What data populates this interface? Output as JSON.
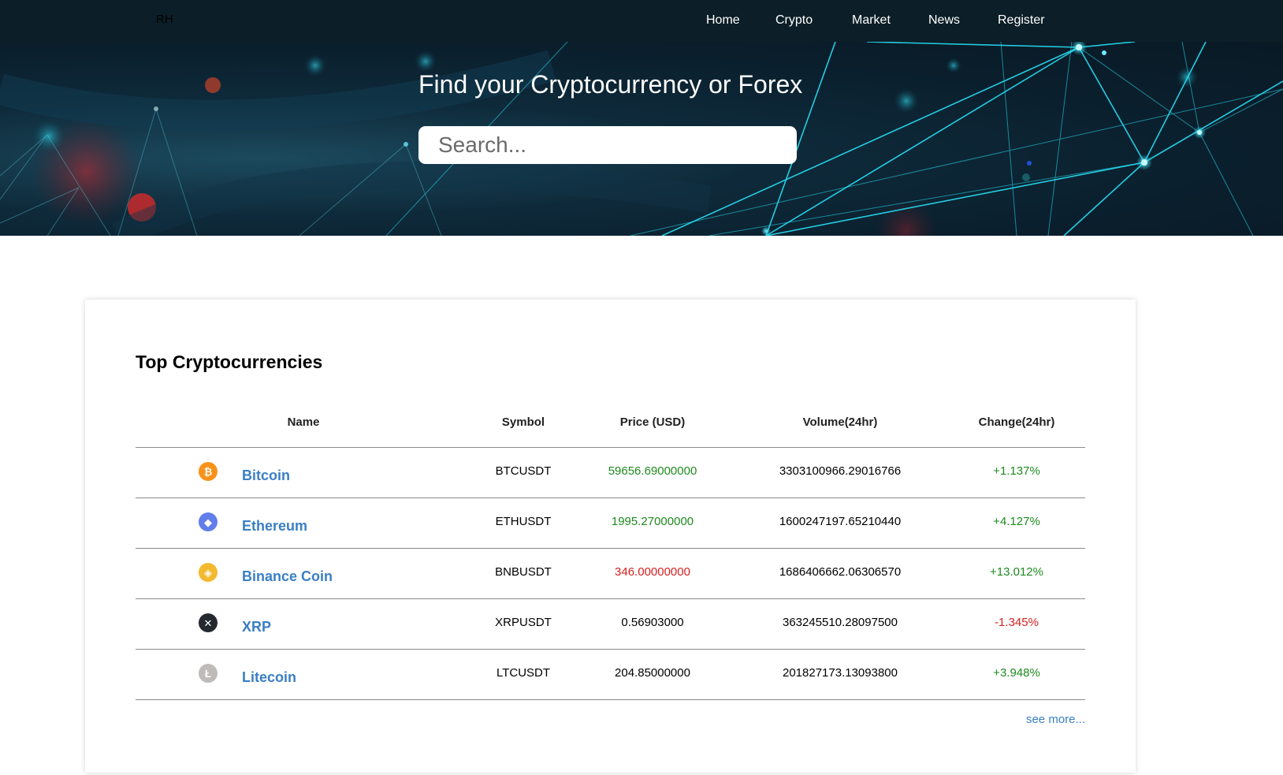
{
  "nav": {
    "logo": "RH",
    "links": [
      "Home",
      "Crypto",
      "Market",
      "News",
      "Register"
    ]
  },
  "hero": {
    "title": "Find your Cryptocurrency or Forex",
    "search_placeholder": "Search..."
  },
  "table": {
    "title": "Top Cryptocurrencies",
    "headers": [
      "Name",
      "Symbol",
      "Price (USD)",
      "Volume(24hr)",
      "Change(24hr)"
    ],
    "rows": [
      {
        "name": "Bitcoin",
        "symbol": "BTCUSDT",
        "price": "59656.69000000",
        "price_color": "green",
        "volume": "3303100966.29016766",
        "change": "+1.137%",
        "change_color": "green",
        "icon": "bitcoin-icon",
        "icon_glyph": "₿",
        "icon_color": "#f7931a"
      },
      {
        "name": "Ethereum",
        "symbol": "ETHUSDT",
        "price": "1995.27000000",
        "price_color": "green",
        "volume": "1600247197.65210440",
        "change": "+4.127%",
        "change_color": "green",
        "icon": "ethereum-icon",
        "icon_glyph": "◆",
        "icon_color": "#627eea"
      },
      {
        "name": "Binance Coin",
        "symbol": "BNBUSDT",
        "price": "346.00000000",
        "price_color": "red",
        "volume": "1686406662.06306570",
        "change": "+13.012%",
        "change_color": "green",
        "icon": "binance-coin-icon",
        "icon_glyph": "◈",
        "icon_color": "#f3ba2f"
      },
      {
        "name": "XRP",
        "symbol": "XRPUSDT",
        "price": "0.56903000",
        "price_color": "default",
        "volume": "363245510.28097500",
        "change": "-1.345%",
        "change_color": "red",
        "icon": "xrp-icon",
        "icon_glyph": "✕",
        "icon_color": "#23292f"
      },
      {
        "name": "Litecoin",
        "symbol": "LTCUSDT",
        "price": "204.85000000",
        "price_color": "default",
        "volume": "201827173.13093800",
        "change": "+3.948%",
        "change_color": "green",
        "icon": "litecoin-icon",
        "icon_glyph": "Ł",
        "icon_color": "#bfbbbb"
      }
    ],
    "see_more": "see more..."
  },
  "colors": {
    "nav_bg": "#0c1e27",
    "link_blue": "#3a7fc4",
    "positive": "#1e8a1e",
    "negative": "#d42020"
  }
}
